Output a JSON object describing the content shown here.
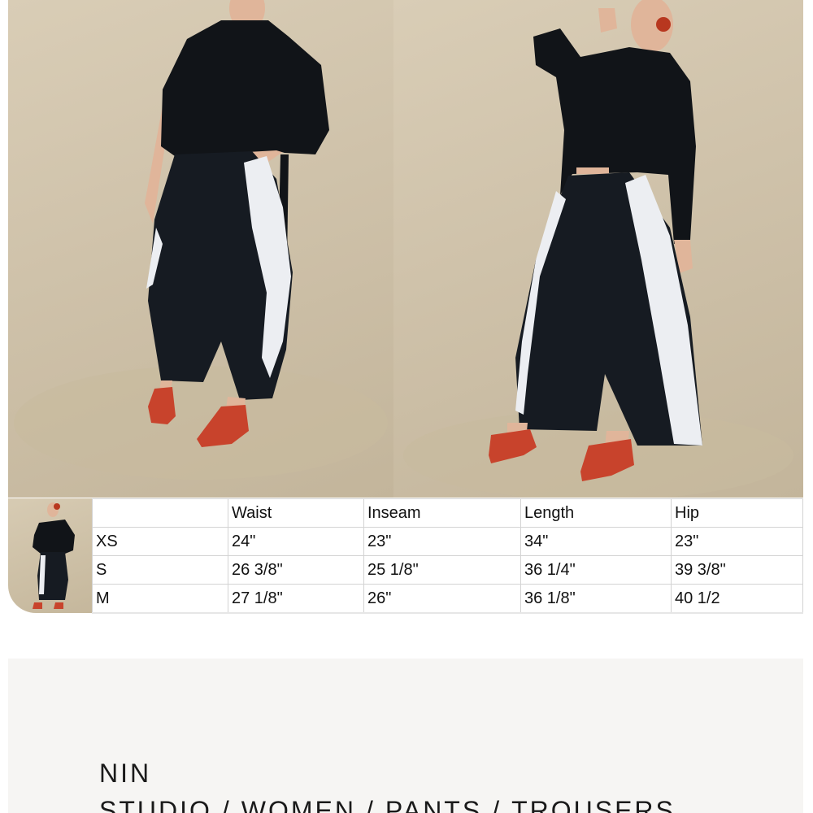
{
  "size_chart": {
    "headers": [
      "",
      "Waist",
      "Inseam",
      "Length",
      "Hip"
    ],
    "rows": [
      [
        "XS",
        "24\"",
        "23\"",
        "34\"",
        "23\""
      ],
      [
        "S",
        "26 3/8\"",
        "25 1/8\"",
        "36 1/4\"",
        "39 3/8\""
      ],
      [
        "M",
        "27 1/8\"",
        "26\"",
        "36 1/8\"",
        "40 1/2"
      ]
    ]
  },
  "breadcrumb": {
    "items": [
      "NIN STUDIO",
      "WOMEN",
      "PANTS",
      "TROUSERS"
    ],
    "separator": "/"
  },
  "colors": {
    "backdrop": "#cfc2aa",
    "top": "#111418",
    "trousers_dark": "#161b22",
    "trousers_panel": "#eceef2",
    "shoes": "#c8432c",
    "info_background": "#f6f5f3"
  }
}
